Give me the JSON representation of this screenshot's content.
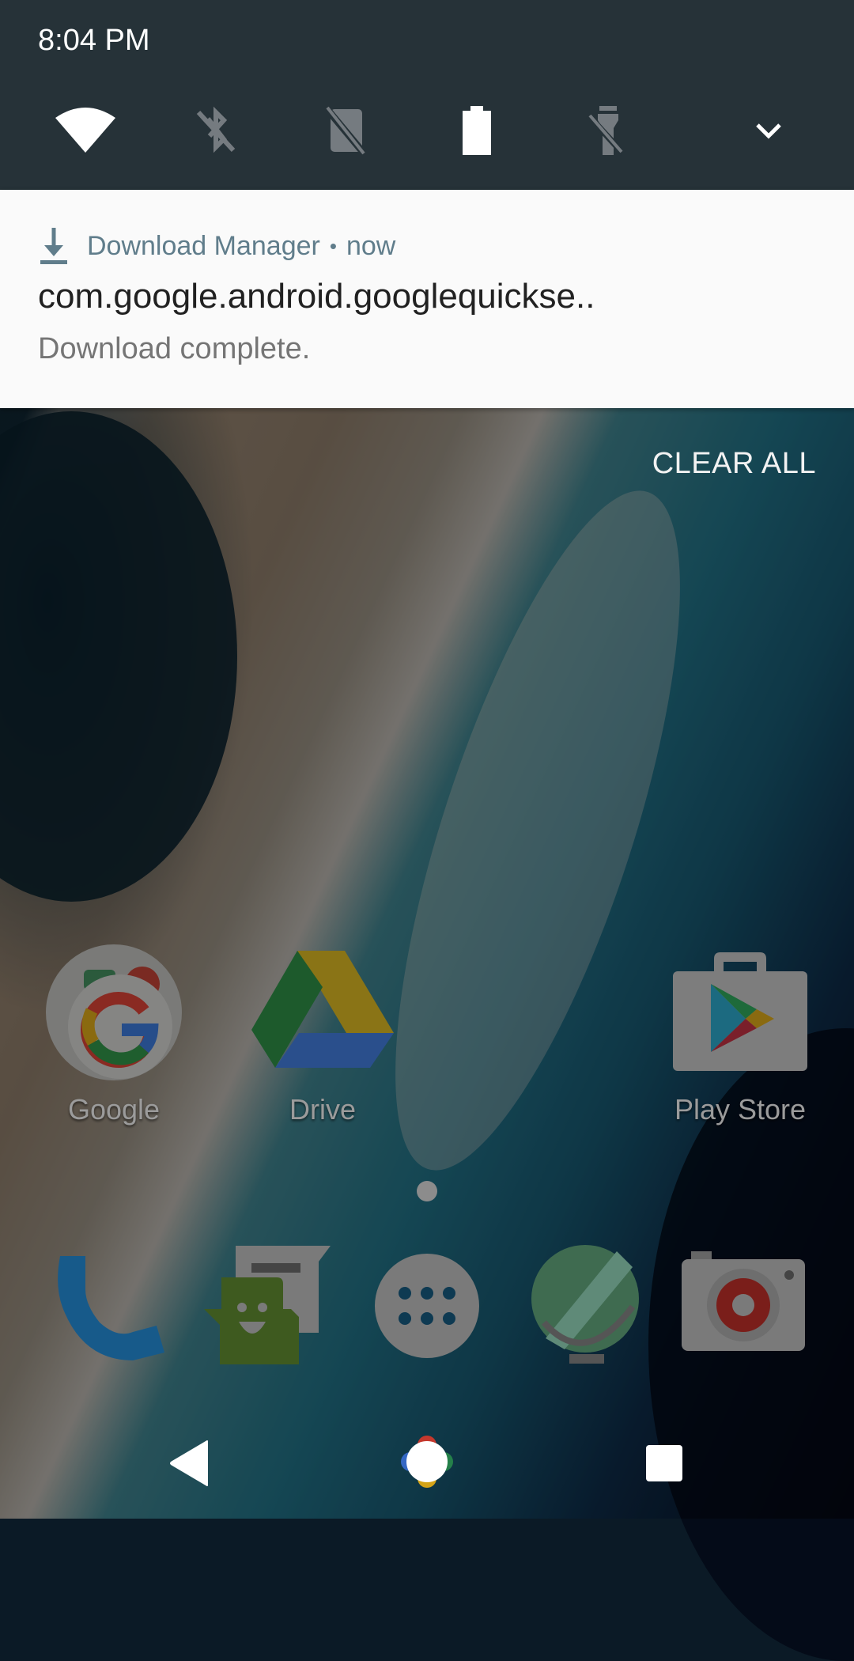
{
  "status": {
    "time": "8:04 PM"
  },
  "quick_settings": {
    "tiles": [
      {
        "name": "wifi",
        "icon": "wifi-icon",
        "state": "on"
      },
      {
        "name": "bluetooth",
        "icon": "bluetooth-off-icon",
        "state": "off"
      },
      {
        "name": "do-not-disturb",
        "icon": "dnd-off-icon",
        "state": "off"
      },
      {
        "name": "battery",
        "icon": "battery-icon",
        "state": "full"
      },
      {
        "name": "flashlight",
        "icon": "flashlight-off-icon",
        "state": "off"
      }
    ],
    "expand_icon": "chevron-down-icon"
  },
  "notification": {
    "icon": "download-icon",
    "app_name": "Download Manager",
    "separator": "•",
    "time": "now",
    "title": "com.google.android.googlequickse..",
    "text": "Download complete.",
    "accent_color": "#607d8b"
  },
  "clear_all_label": "CLEAR ALL",
  "home": {
    "apps": [
      {
        "label": "Google",
        "icon": "google-folder-icon"
      },
      {
        "label": "Drive",
        "icon": "google-drive-icon"
      },
      {
        "label": "Play Store",
        "icon": "play-store-icon"
      }
    ],
    "page_indicator": {
      "pages": 1,
      "current": 1
    },
    "dock": [
      {
        "name": "phone",
        "icon": "phone-icon"
      },
      {
        "name": "messenger",
        "icon": "messenger-icon"
      },
      {
        "name": "app-drawer",
        "icon": "app-drawer-icon"
      },
      {
        "name": "browser",
        "icon": "globe-icon"
      },
      {
        "name": "camera",
        "icon": "camera-icon"
      }
    ]
  },
  "navbar": {
    "back": "back-icon",
    "home": "home-icon",
    "recents": "recents-icon"
  }
}
